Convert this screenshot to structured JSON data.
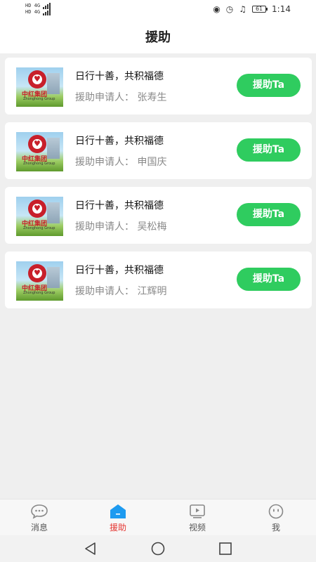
{
  "status": {
    "left_line1": "HD 4G",
    "left_line2": "HD 4G",
    "battery": "61",
    "time": "1:14"
  },
  "header": {
    "title": "援助"
  },
  "items": [
    {
      "title": "日行十善，共积福德",
      "applicant": "援助申请人： 张寿生",
      "button": "援助Ta",
      "brand": "中红集团",
      "brand_en": "Zhonghong Group"
    },
    {
      "title": "日行十善，共积福德",
      "applicant": "援助申请人： 申国庆",
      "button": "援助Ta",
      "brand": "中红集团",
      "brand_en": "Zhonghong Group"
    },
    {
      "title": "日行十善，共积福德",
      "applicant": "援助申请人： 吴松梅",
      "button": "援助Ta",
      "brand": "中红集团",
      "brand_en": "Zhonghong Group"
    },
    {
      "title": "日行十善，共积福德",
      "applicant": "援助申请人： 江辉明",
      "button": "援助Ta",
      "brand": "中红集团",
      "brand_en": "Zhonghong Group"
    }
  ],
  "tabs": [
    {
      "label": "消息",
      "icon": "message-icon",
      "active": false
    },
    {
      "label": "援助",
      "icon": "home-icon",
      "active": true
    },
    {
      "label": "视频",
      "icon": "video-icon",
      "active": false
    },
    {
      "label": "我",
      "icon": "profile-icon",
      "active": false
    }
  ],
  "colors": {
    "accent_green": "#2fcc5f",
    "active_tab": "#e53935",
    "active_icon": "#1e9bf0"
  }
}
